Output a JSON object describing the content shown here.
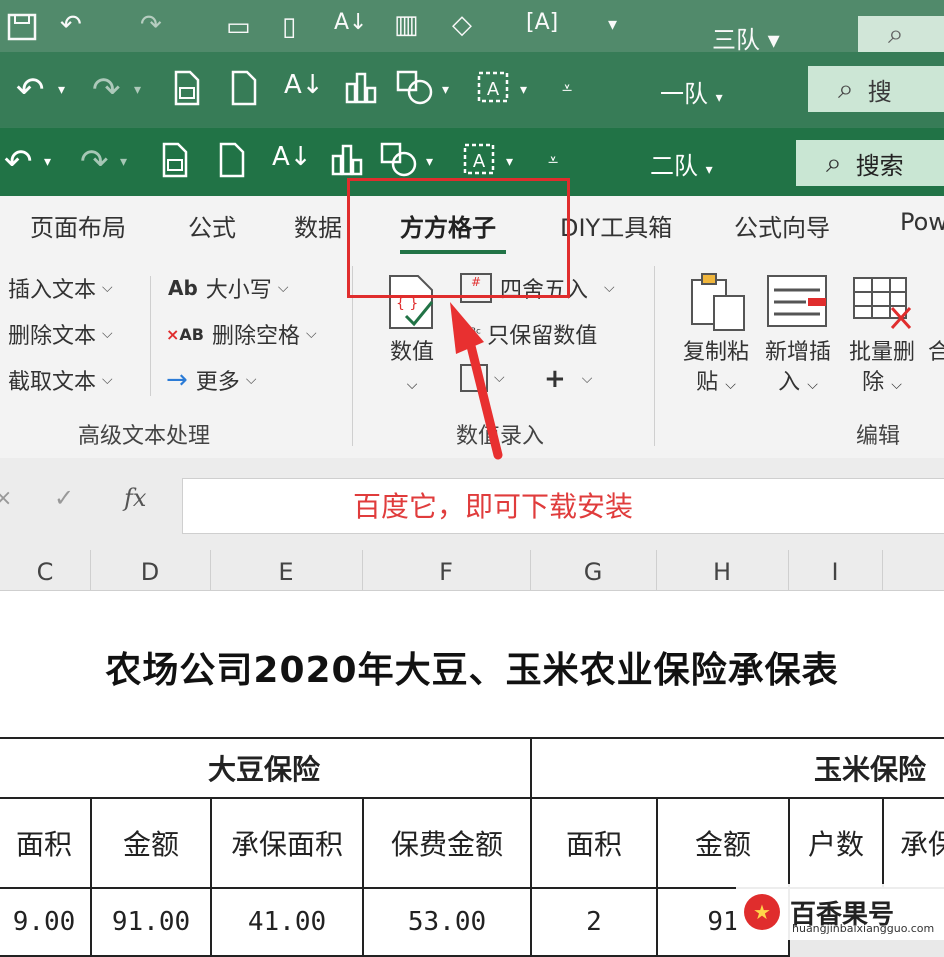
{
  "qat": {
    "team_bar1": "三队",
    "team_bar2": "一队",
    "team_bar3": "二队",
    "search_label": "搜索",
    "search_label_partial": "搜"
  },
  "ribbon": {
    "tabs": [
      "页面布局",
      "公式",
      "数据",
      "方方格子",
      "DIY工具箱",
      "公式向导",
      "Pow"
    ],
    "active_tab": "方方格子",
    "text_group": {
      "insert_text": "插入文本",
      "delete_text": "删除文本",
      "extract_text": "截取文本",
      "case": "大小写",
      "delete_spaces": "删除空格",
      "more": "更多",
      "label": "高级文本处理"
    },
    "number_group": {
      "value_button": "数值",
      "round": "四舍五入",
      "keep_values": "只保留数值",
      "label": "数值录入"
    },
    "edit_group": {
      "copy_paste": [
        "复制粘",
        "贴"
      ],
      "new_insert": [
        "新增插",
        "入"
      ],
      "batch_delete": [
        "批量删",
        "除"
      ],
      "merge_partial": "合",
      "label": "编辑"
    }
  },
  "formula_bar": {
    "fx": "fx",
    "content": "百度它，即可下载安装"
  },
  "columns": [
    "C",
    "D",
    "E",
    "F",
    "G",
    "H",
    "I"
  ],
  "sheet": {
    "title": "农场公司2020年大豆、玉米农业保险承保表",
    "soy_header": "大豆保险",
    "corn_header": "玉米保险",
    "subheaders": [
      "面积",
      "金额",
      "承保面积",
      "保费金额",
      "面积",
      "金额",
      "户数",
      "承保"
    ],
    "row1": [
      "9.00",
      "91.00",
      "41.00",
      "53.00",
      "2",
      "91"
    ]
  },
  "watermark": {
    "name": "百香果号",
    "url": "huangjinbaixiangguo.com"
  },
  "colors": {
    "excel_green": "#217346",
    "highlight_red": "#e02d2d"
  }
}
